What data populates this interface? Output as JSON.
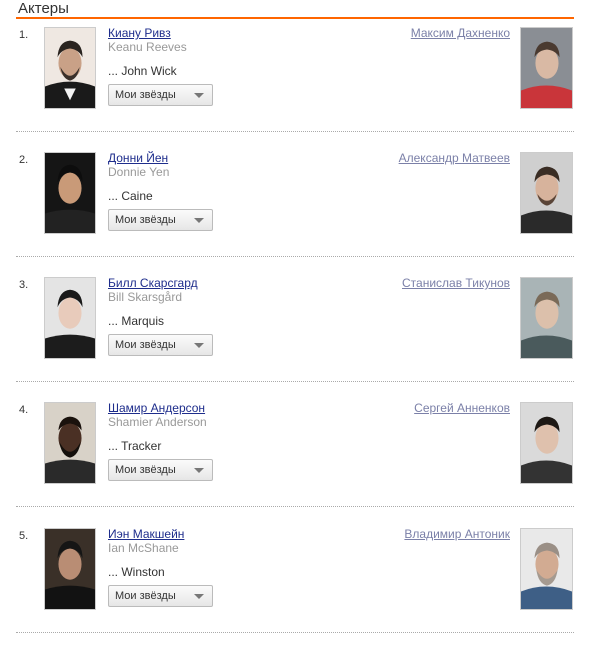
{
  "section": {
    "title": "Актеры"
  },
  "select_label": "Мои звёзды",
  "actors": [
    {
      "num": "1.",
      "name_ru": "Киану Ривз",
      "name_en": "Keanu Reeves",
      "role": "... John Wick",
      "dub_name": "Максим Дахненко"
    },
    {
      "num": "2.",
      "name_ru": "Донни Йен",
      "name_en": "Donnie Yen",
      "role": "... Caine",
      "dub_name": "Александр Матвеев"
    },
    {
      "num": "3.",
      "name_ru": "Билл Скарсгард",
      "name_en": "Bill Skarsgård",
      "role": "... Marquis",
      "dub_name": "Станислав Тикунов"
    },
    {
      "num": "4.",
      "name_ru": "Шамир Андерсон",
      "name_en": "Shamier Anderson",
      "role": "... Tracker",
      "dub_name": "Сергей Анненков"
    },
    {
      "num": "5.",
      "name_ru": "Иэн Макшейн",
      "name_en": "Ian McShane",
      "role": "... Winston",
      "dub_name": "Владимир Антоник"
    }
  ]
}
